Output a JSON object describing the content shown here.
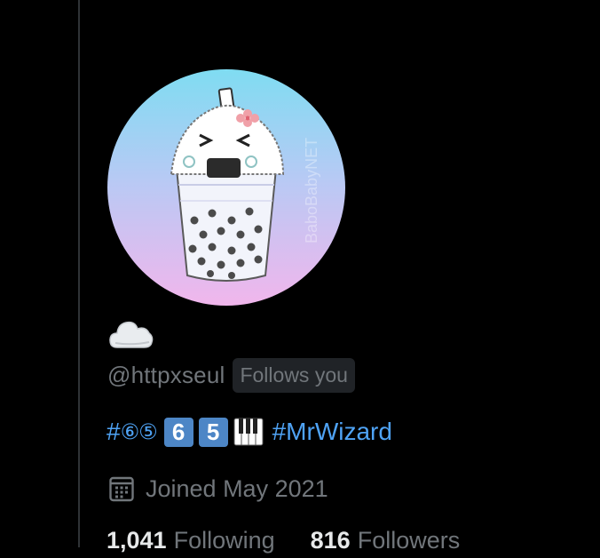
{
  "profile": {
    "display_name_icon": "cloud-icon",
    "handle": "@httpxseul",
    "follows_you_badge": "Follows you",
    "bio": {
      "hashtag_symbol": "#",
      "circled_digits": "⑥⑤",
      "keycap_six": "6",
      "keycap_five": "5",
      "piano_icon": "piano-keys-icon",
      "hashtag_link": "#MrWizard"
    },
    "joined": {
      "icon": "calendar-icon",
      "text": "Joined May 2021"
    },
    "stats": {
      "following_count": "1,041",
      "following_label": "Following",
      "followers_count": "816",
      "followers_label": "Followers"
    },
    "avatar": {
      "watermark": "BaboBabyNET"
    }
  },
  "colors": {
    "background": "#000000",
    "secondary_text": "#71767b",
    "link": "#4fa3f5",
    "keycap": "#4d86c6",
    "badge_bg": "#202327"
  }
}
